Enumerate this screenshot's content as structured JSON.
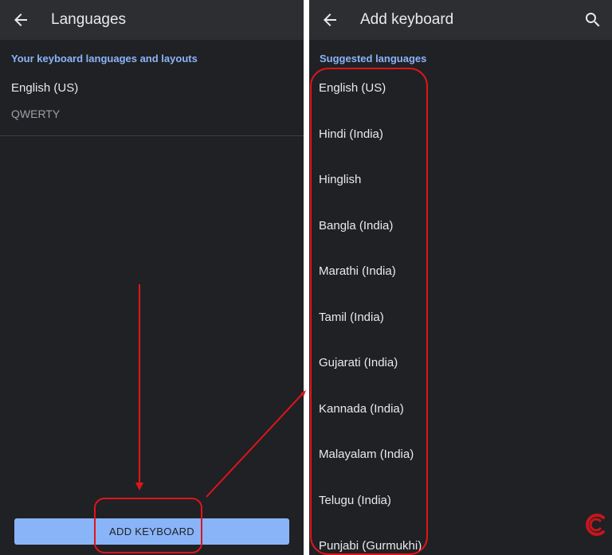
{
  "left_screen": {
    "title": "Languages",
    "section_header": "Your keyboard languages and layouts",
    "language": "English (US)",
    "layout": "QWERTY",
    "add_button_label": "ADD KEYBOARD"
  },
  "right_screen": {
    "title": "Add keyboard",
    "section_header": "Suggested languages",
    "languages": [
      "English (US)",
      "Hindi (India)",
      "Hinglish",
      "Bangla (India)",
      "Marathi (India)",
      "Tamil (India)",
      "Gujarati (India)",
      "Kannada (India)",
      "Malayalam (India)",
      "Telugu (India)",
      "Punjabi (Gurmukhi)"
    ]
  },
  "icons": {
    "back": "arrow-back-icon",
    "search": "search-icon"
  },
  "colors": {
    "background": "#202124",
    "appbar": "#2d2e31",
    "accent": "#8ab4f8",
    "annotation": "#e0141c"
  }
}
